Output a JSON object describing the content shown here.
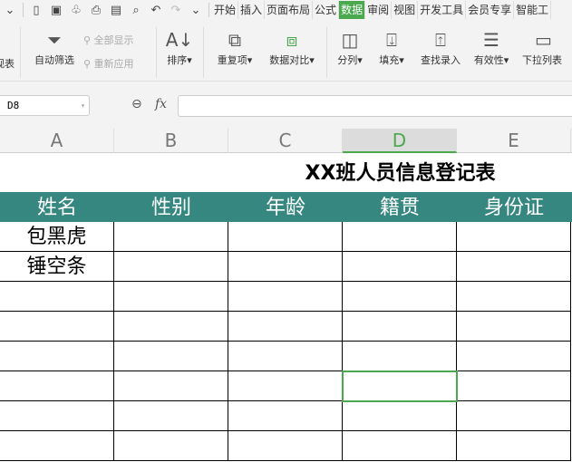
{
  "quick_access": {
    "icons": [
      "new-file-icon",
      "save-icon",
      "format-painter-icon",
      "print-icon",
      "print-preview-icon",
      "find-icon",
      "undo-icon",
      "redo-icon",
      "more-icon"
    ]
  },
  "tabs": [
    "开始",
    "插入",
    "页面布局",
    "公式",
    "数据",
    "审阅",
    "视图",
    "开发工具",
    "会员专享",
    "智能工"
  ],
  "active_tab": "数据",
  "ribbon": {
    "left_partial": "视表",
    "auto_filter": "自动筛选",
    "show_all": "全部显示",
    "reapply": "重新应用",
    "sort": "排序",
    "duplicates": "重复项",
    "data_compare": "数据对比",
    "split_column": "分列",
    "fill": "填充",
    "find_entry": "查找录入",
    "validity": "有效性",
    "dropdown_list": "下拉列表"
  },
  "name_box": "D8",
  "formula_fx": "fx",
  "columns": [
    "A",
    "B",
    "C",
    "D",
    "E"
  ],
  "selected_column": "D",
  "sheet": {
    "title": "XX班人员信息登记表",
    "headers": [
      "姓名",
      "性别",
      "年龄",
      "籍贯",
      "身份证"
    ],
    "rows": [
      [
        "包黑虎",
        "",
        "",
        "",
        ""
      ],
      [
        "锤空条",
        "",
        "",
        "",
        ""
      ],
      [
        "",
        "",
        "",
        "",
        ""
      ],
      [
        "",
        "",
        "",
        "",
        ""
      ],
      [
        "",
        "",
        "",
        "",
        ""
      ],
      [
        "",
        "",
        "",
        "",
        ""
      ],
      [
        "",
        "",
        "",
        "",
        ""
      ],
      [
        "",
        "",
        "",
        "",
        ""
      ]
    ]
  },
  "colors": {
    "header_bg": "#368780",
    "accent": "#4aa84f"
  }
}
